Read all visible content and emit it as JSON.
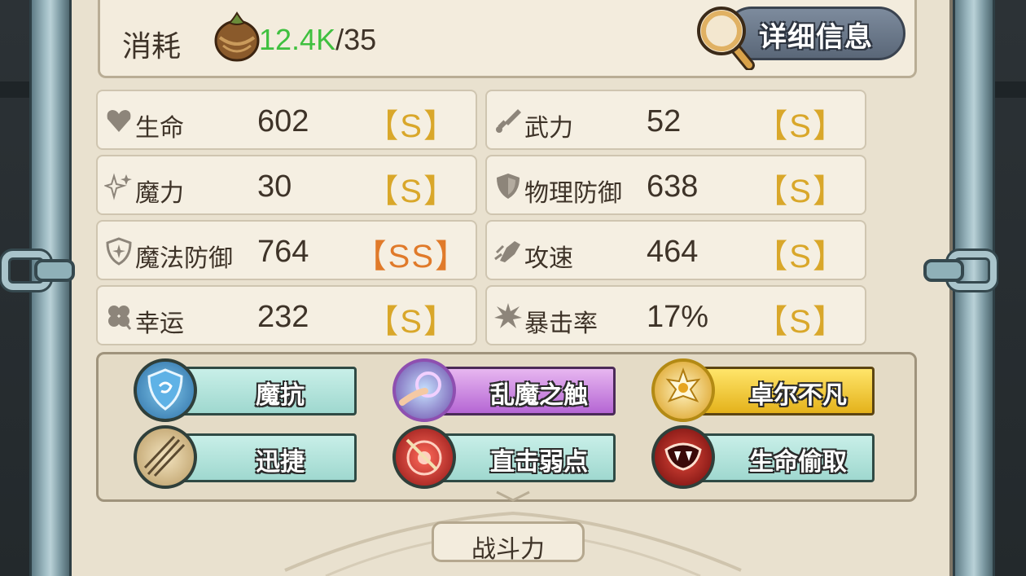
{
  "cost": {
    "label": "消耗",
    "current": "12.4K",
    "separator": "/",
    "max": "35",
    "icon": "nut-icon"
  },
  "detail_button": {
    "label": "详细信息",
    "icon": "magnifier-icon"
  },
  "stats": [
    {
      "key": "hp",
      "name": "生命",
      "value": "602",
      "grade": "【S】",
      "icon": "heart-icon"
    },
    {
      "key": "atk",
      "name": "武力",
      "value": "52",
      "grade": "【S】",
      "icon": "sword-icon"
    },
    {
      "key": "mag",
      "name": "魔力",
      "value": "30",
      "grade": "【S】",
      "icon": "sparkle-icon"
    },
    {
      "key": "pdef",
      "name": "物理防御",
      "value": "638",
      "grade": "【S】",
      "icon": "shield-icon"
    },
    {
      "key": "mdef",
      "name": "魔法防御",
      "value": "764",
      "grade": "【SS】",
      "icon": "magic-shield-icon"
    },
    {
      "key": "spd",
      "name": "攻速",
      "value": "464",
      "grade": "【S】",
      "icon": "fist-icon"
    },
    {
      "key": "luck",
      "name": "幸运",
      "value": "232",
      "grade": "【S】",
      "icon": "clover-icon"
    },
    {
      "key": "crit",
      "name": "暴击率",
      "value": "17%",
      "grade": "【S】",
      "icon": "burst-icon"
    }
  ],
  "skills": [
    {
      "name": "魔抗",
      "rarity": "common",
      "icon": "blue-shield-skill-icon"
    },
    {
      "name": "乱魔之触",
      "rarity": "epic",
      "icon": "magic-touch-skill-icon"
    },
    {
      "name": "卓尔不凡",
      "rarity": "legendary",
      "icon": "golden-emblem-skill-icon"
    },
    {
      "name": "迅捷",
      "rarity": "common",
      "icon": "arrows-skill-icon"
    },
    {
      "name": "直击弱点",
      "rarity": "common",
      "icon": "target-skill-icon"
    },
    {
      "name": "生命偷取",
      "rarity": "common",
      "icon": "fang-skill-icon"
    }
  ],
  "power": {
    "label": "战斗力"
  },
  "colors": {
    "cost_current": "#3fc03f",
    "grade_s": "#d9a72a",
    "grade_ss": "#e07a2a",
    "parchment": "#e9e1cf"
  }
}
